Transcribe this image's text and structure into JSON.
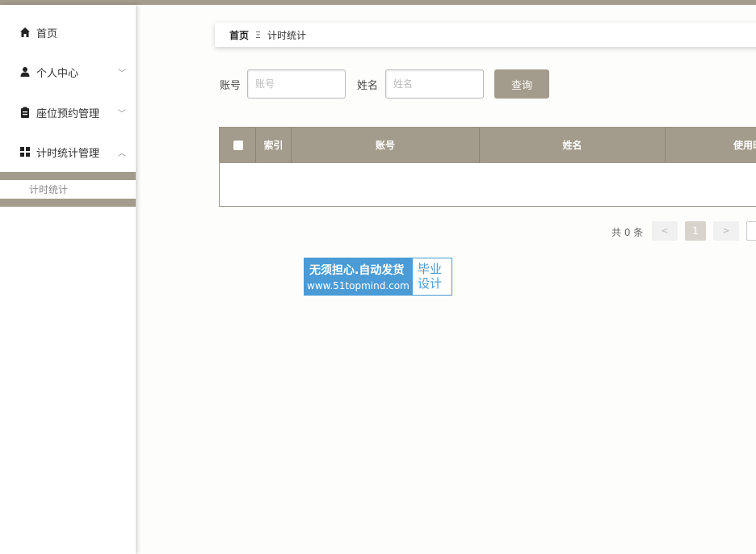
{
  "sidebar": {
    "items": [
      {
        "label": "首页",
        "icon": "home-icon"
      },
      {
        "label": "个人中心",
        "icon": "user-icon",
        "chevron": "down"
      },
      {
        "label": "座位预约管理",
        "icon": "clipboard-icon",
        "chevron": "down"
      },
      {
        "label": "计时统计管理",
        "icon": "grid-icon",
        "chevron": "up"
      }
    ],
    "submenu": {
      "label": "计时统计"
    },
    "chevron_down": "﹀",
    "chevron_up": "︿"
  },
  "breadcrumb": {
    "home": "首页",
    "separator": "Ξ",
    "current": "计时统计"
  },
  "search": {
    "account_label": "账号",
    "account_placeholder": "账号",
    "name_label": "姓名",
    "name_placeholder": "姓名",
    "button": "查询"
  },
  "table": {
    "headers": [
      "索引",
      "账号",
      "姓名",
      "使用时"
    ]
  },
  "pagination": {
    "total": "共 0 条",
    "prev": "<",
    "current": "1",
    "next": ">"
  },
  "watermark": {
    "line1": "无须担心.自动发货",
    "line2": "www.51topmind.com",
    "right_line1": "毕业",
    "right_line2": "设计"
  },
  "colors": {
    "accent": "#a39b8b",
    "watermark_blue": "#4a9bd6"
  }
}
